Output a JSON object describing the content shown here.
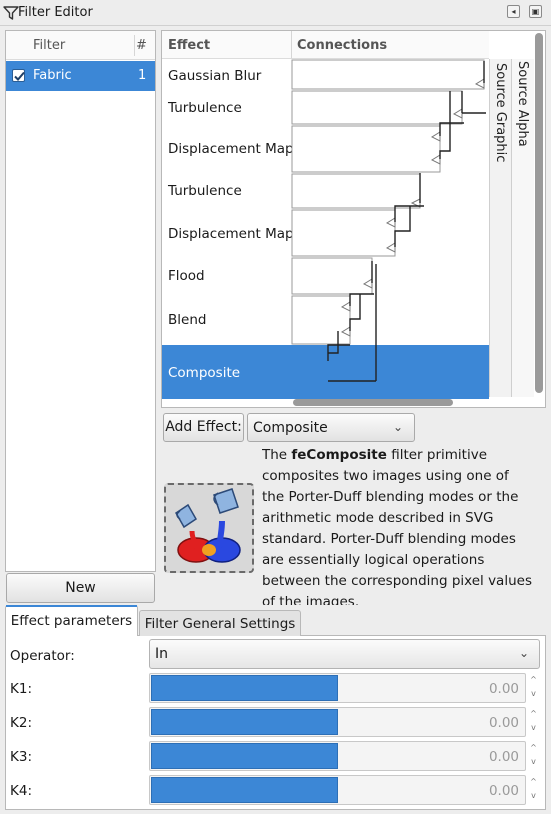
{
  "window": {
    "title": "Filter Editor",
    "buttons": {
      "restore": "◂",
      "close": "▣"
    }
  },
  "filter_list": {
    "columns": {
      "name": "Filter",
      "count": "#"
    },
    "rows": [
      {
        "name": "Fabric",
        "count": "1",
        "checked": true
      }
    ],
    "new_label": "New"
  },
  "effects": {
    "columns": {
      "effect": "Effect",
      "connections": "Connections"
    },
    "items": [
      "Gaussian Blur",
      "Turbulence",
      "Displacement Map",
      "Turbulence",
      "Displacement Map",
      "Flood",
      "Blend",
      "Composite"
    ],
    "selected_index": 7,
    "sources": [
      "Source Graphic",
      "Source Alpha"
    ]
  },
  "add_effect": {
    "button_label": "Add Effect:",
    "selected": "Composite"
  },
  "description": {
    "prefix": "The ",
    "name": "feComposite",
    "body": " filter primitive composites two images using one of the Porter-Duff blending modes or the arithmetic mode described in SVG standard. Porter-Duff blending modes are essentially logical operations between the corresponding pixel values of the images."
  },
  "tabs": {
    "effect_parameters": "Effect parameters",
    "general_settings": "Filter General Settings"
  },
  "parameters": {
    "operator": {
      "label": "Operator:",
      "value": "In"
    },
    "k": [
      {
        "label": "K1:",
        "value": "0.00",
        "fill_fraction": 0.5
      },
      {
        "label": "K2:",
        "value": "0.00",
        "fill_fraction": 0.5
      },
      {
        "label": "K3:",
        "value": "0.00",
        "fill_fraction": 0.5
      },
      {
        "label": "K4:",
        "value": "0.00",
        "fill_fraction": 0.5
      }
    ]
  },
  "colors": {
    "accent": "#3c87d6",
    "panel_bg": "#ededed"
  },
  "icons": {
    "title": "filter-funnel-icon",
    "composite": "composite-paint-buckets-icon"
  }
}
